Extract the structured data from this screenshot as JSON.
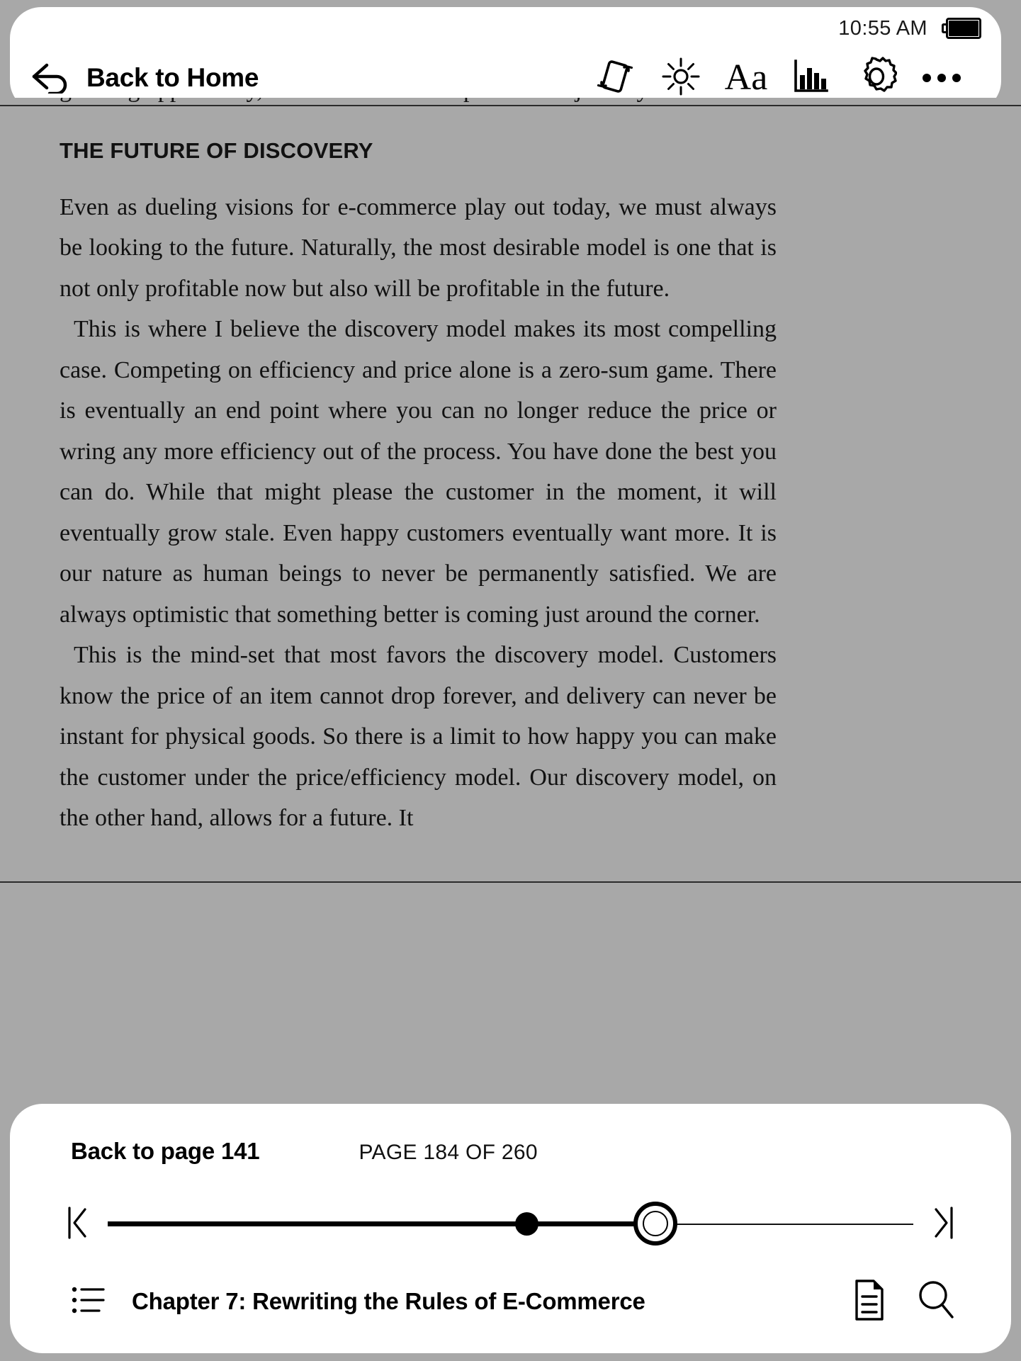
{
  "status": {
    "time": "10:55 AM",
    "battery_icon": "battery-full-icon"
  },
  "header": {
    "back_label": "Back to Home",
    "back_icon": "back-arrow-icon",
    "tools": [
      {
        "name": "rotate-screen-icon",
        "label": "Rotate screen"
      },
      {
        "name": "brightness-icon",
        "label": "Brightness"
      },
      {
        "name": "font-size-icon",
        "label": "Aa"
      },
      {
        "name": "reading-stats-icon",
        "label": "Reading stats"
      },
      {
        "name": "settings-gear-icon",
        "label": "Settings"
      },
      {
        "name": "more-options-icon",
        "label": "More"
      }
    ]
  },
  "page": {
    "clipped_top_line": "growing opportunity, and we intend to be part of that journey.",
    "section_heading": "THE FUTURE OF DISCOVERY",
    "paragraphs": [
      "Even as dueling visions for e-commerce play out today, we must always be looking to the future. Naturally, the most desirable model is one that is not only profitable now but also will be profitable in the future.",
      "This is where I believe the discovery model makes its most compelling case. Competing on efficiency and price alone is a zero-sum game. There is eventually an end point where you can no longer reduce the price or wring any more efficiency out of the process. You have done the best you can do. While that might please the customer in the moment, it will eventually grow stale. Even happy customers eventually want more. It is our nature as human beings to never be permanently satisfied. We are always optimistic that something better is coming just around the corner.",
      "This is the mind-set that most favors the discovery model. Customers know the price of an item cannot drop forever, and delivery can never be instant for physical goods. So there is a limit to how happy you can make the customer under the price/efficiency model. Our discovery model, on the other hand, allows for a future. It"
    ]
  },
  "bottom": {
    "back_to_page_label": "Back to page 141",
    "page_indicator": "PAGE 184 OF 260",
    "slider": {
      "first_page_icon": "go-to-start-icon",
      "last_page_icon": "go-to-end-icon",
      "thumb_icon": "slider-thumb-icon",
      "bookmark_icon": "bookmark-position-icon",
      "progress_percent": 68,
      "bookmark_percent": 52
    },
    "chapter_title": "Chapter 7: Rewriting the Rules of E-Commerce",
    "toc_icon": "table-of-contents-icon",
    "notes_icon": "notes-document-icon",
    "search_icon": "search-icon"
  },
  "colors": {
    "page_background": "#a8a8a8",
    "panel_background": "#ffffff",
    "text": "#111111"
  }
}
